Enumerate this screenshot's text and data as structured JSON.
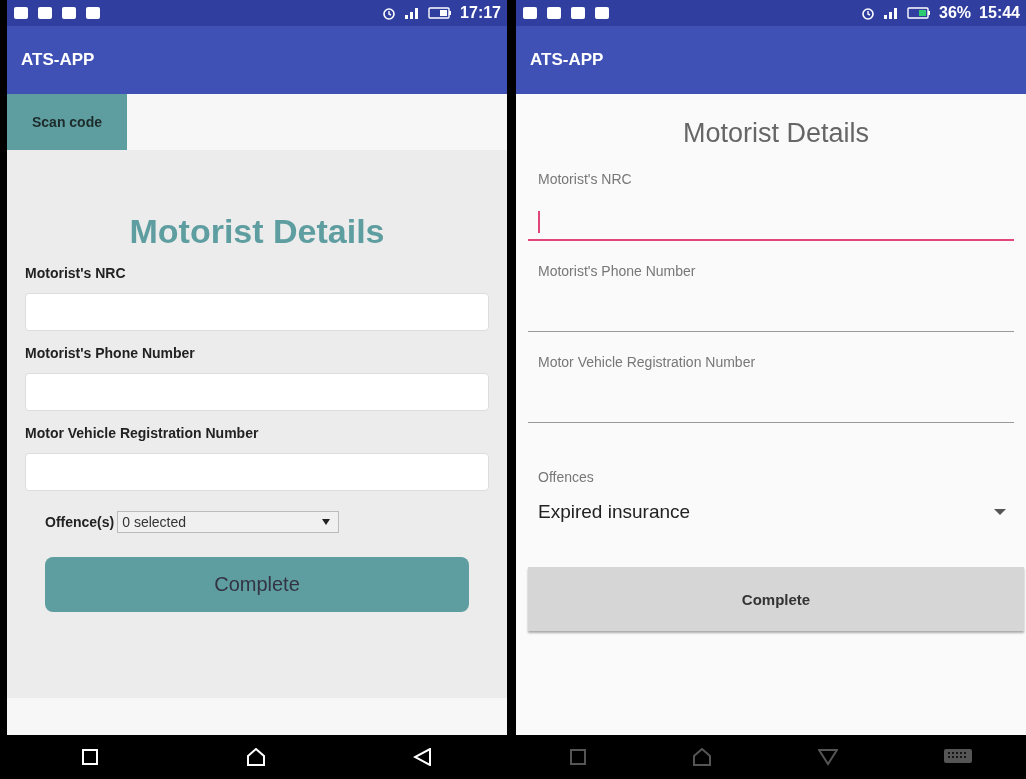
{
  "screens": [
    {
      "kind": "web",
      "status_bar": {
        "time": "17:17"
      },
      "app_bar": {
        "title": "ATS-APP"
      },
      "scan_button": "Scan code",
      "heading": "Motorist Details",
      "fields": [
        {
          "label": "Motorist's NRC",
          "focused": false
        },
        {
          "label": "Motorist's Phone Number",
          "focused": false
        },
        {
          "label": "Motor Vehicle Registration Number",
          "focused": false
        }
      ],
      "offences": {
        "label": "Offence(s)",
        "value": "0 selected"
      },
      "complete_button": "Complete"
    },
    {
      "kind": "material",
      "status_bar": {
        "battery": "36%",
        "time": "15:44"
      },
      "app_bar": {
        "title": "ATS-APP"
      },
      "heading": "Motorist Details",
      "fields": [
        {
          "label": "Motorist's NRC",
          "focused": true
        },
        {
          "label": "Motorist's Phone Number",
          "focused": false
        },
        {
          "label": "Motor Vehicle Registration Number",
          "focused": false
        }
      ],
      "offences": {
        "label": "Offences",
        "value": "Expired insurance"
      },
      "complete_button": "Complete"
    }
  ]
}
